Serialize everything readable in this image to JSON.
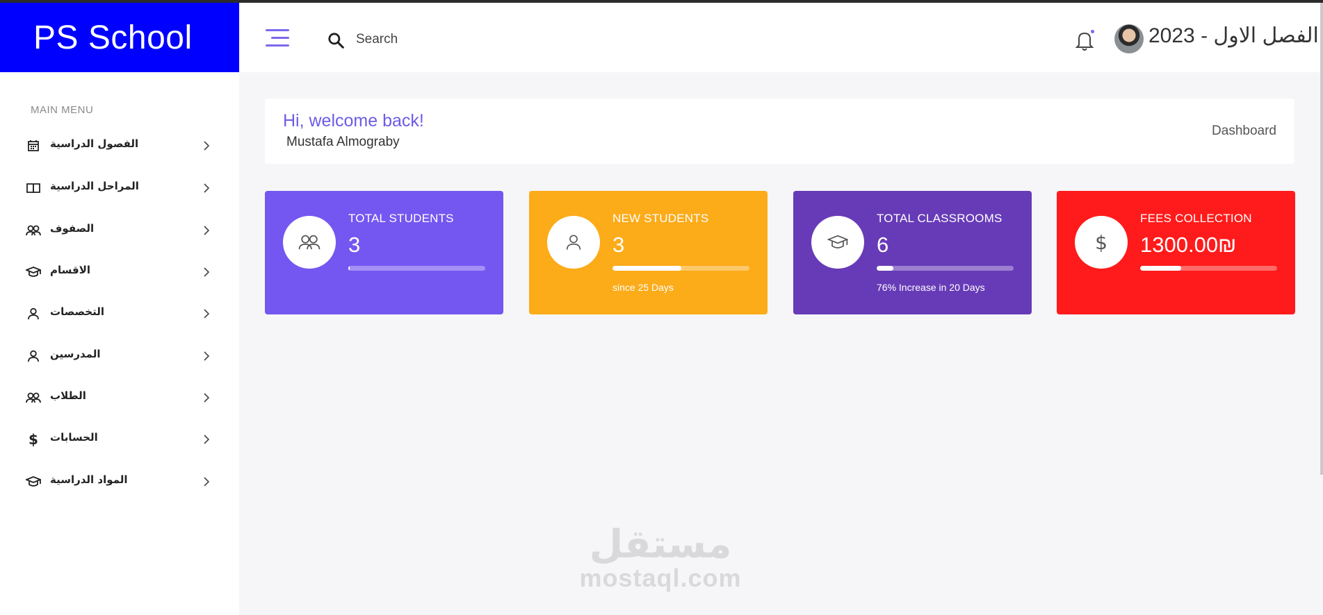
{
  "brand": {
    "title": "PS School",
    "bg_color": "#0000ff"
  },
  "header": {
    "search_placeholder": "Search",
    "semester": "الفصل الاول - 2023",
    "accent_color": "#7b68ee"
  },
  "sidebar": {
    "menu_title": "MAIN MENU",
    "items": [
      {
        "label": "الفصول الدراسية",
        "icon": "calendar-icon"
      },
      {
        "label": "المراحل الدراسية",
        "icon": "book-icon"
      },
      {
        "label": "الصفوف",
        "icon": "users-icon"
      },
      {
        "label": "الاقسام",
        "icon": "graduation-cap-icon"
      },
      {
        "label": "التخصصات",
        "icon": "user-icon"
      },
      {
        "label": "المدرسين",
        "icon": "user-icon"
      },
      {
        "label": "الطلاب",
        "icon": "users-icon"
      },
      {
        "label": "الحسابات",
        "icon": "dollar-icon"
      },
      {
        "label": "المواد الدراسية",
        "icon": "graduation-cap-icon"
      }
    ]
  },
  "welcome": {
    "greeting": "Hi, welcome back!",
    "user_name": "Mustafa Almograby",
    "breadcrumb": "Dashboard"
  },
  "cards": [
    {
      "title": "TOTAL STUDENTS",
      "value": "3",
      "progress": 0.01,
      "note": "",
      "icon": "users-icon",
      "color": "#7457f0"
    },
    {
      "title": "NEW STUDENTS",
      "value": "3",
      "progress": 0.5,
      "note": "since 25 Days",
      "icon": "user-icon",
      "color": "#fcab19"
    },
    {
      "title": "TOTAL CLASSROOMS",
      "value": "6",
      "progress": 0.12,
      "note": "76% Increase in 20 Days",
      "icon": "graduation-cap-icon",
      "color": "#673bb7"
    },
    {
      "title": "FEES COLLECTION",
      "value": "1300.00₪",
      "progress": 0.3,
      "note": "",
      "icon": "dollar-icon",
      "color": "#ff1b1b"
    }
  ],
  "watermark": {
    "arabic": "مستقل",
    "latin": "mostaql.com"
  }
}
